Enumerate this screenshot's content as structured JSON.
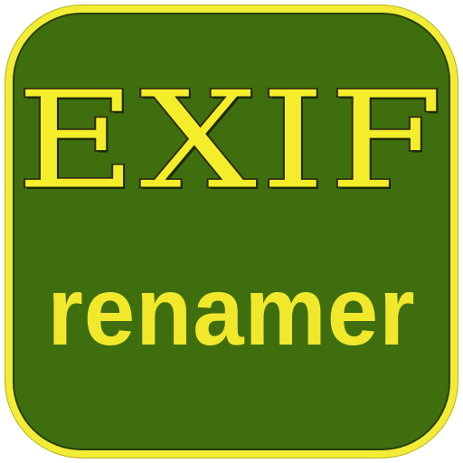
{
  "app_icon": {
    "title": "EXIF",
    "subtitle": "renamer",
    "colors": {
      "background": "#3f6e0f",
      "border": "#f2ec36",
      "text": "#f4ee2a",
      "text_outline": "#2f2a12"
    }
  }
}
